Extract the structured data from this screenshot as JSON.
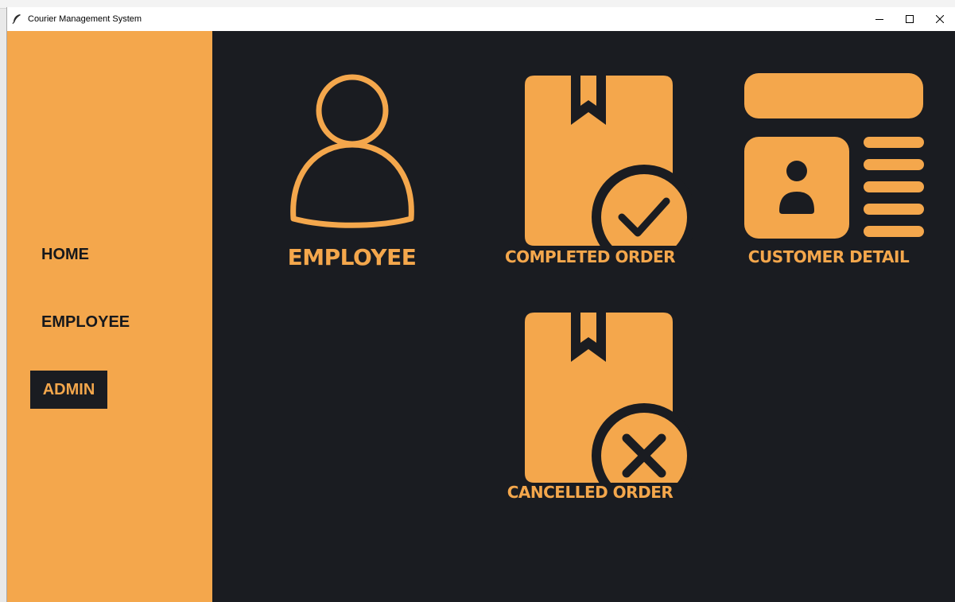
{
  "window": {
    "title": "Courier Management System",
    "controls": {
      "minimize": "minimize-icon",
      "maximize": "maximize-icon",
      "close": "close-icon"
    }
  },
  "sidebar": {
    "items": [
      {
        "label": "HOME",
        "active": false
      },
      {
        "label": "EMPLOYEE",
        "active": false
      },
      {
        "label": "ADMIN",
        "active": true
      }
    ]
  },
  "main": {
    "tiles": [
      {
        "label": "EMPLOYEE",
        "icon": "person-outline-icon"
      },
      {
        "label": "COMPLETED ORDER",
        "icon": "package-check-icon"
      },
      {
        "label": "CUSTOMER DETAIL",
        "icon": "id-card-icon"
      },
      {
        "label": "CANCELLED ORDER",
        "icon": "package-cancel-icon"
      }
    ]
  },
  "colors": {
    "accent": "#f4a74c",
    "background": "#1a1c21",
    "sidebar": "#f4a74c",
    "sidebar_text": "#16181c"
  }
}
